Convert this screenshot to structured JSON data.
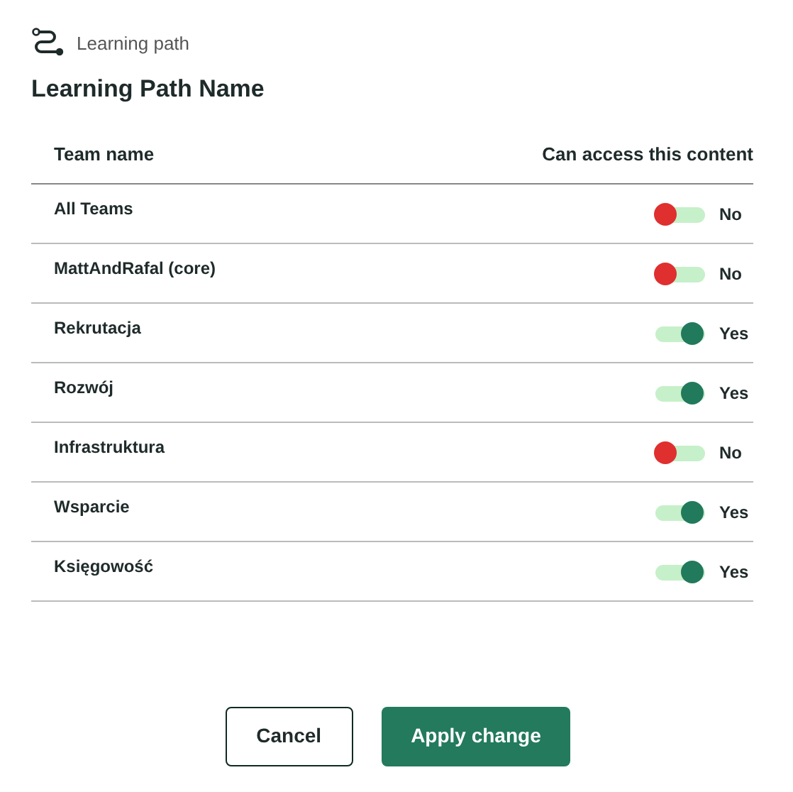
{
  "header": {
    "label": "Learning path"
  },
  "title": "Learning Path Name",
  "table": {
    "columns": [
      "Team name",
      "Can access this content"
    ],
    "rows": [
      {
        "name": "All Teams",
        "on": false,
        "value": "No"
      },
      {
        "name": "MattAndRafal (core)",
        "on": false,
        "value": "No"
      },
      {
        "name": "Rekrutacja",
        "on": true,
        "value": "Yes"
      },
      {
        "name": "Rozwój",
        "on": true,
        "value": "Yes"
      },
      {
        "name": "Infrastruktura",
        "on": false,
        "value": "No"
      },
      {
        "name": "Wsparcie",
        "on": true,
        "value": "Yes"
      },
      {
        "name": "Księgowość",
        "on": true,
        "value": "Yes"
      }
    ]
  },
  "buttons": [
    {
      "label": "Cancel",
      "kind": "secondary"
    },
    {
      "label": "Apply change",
      "kind": "primary"
    }
  ]
}
